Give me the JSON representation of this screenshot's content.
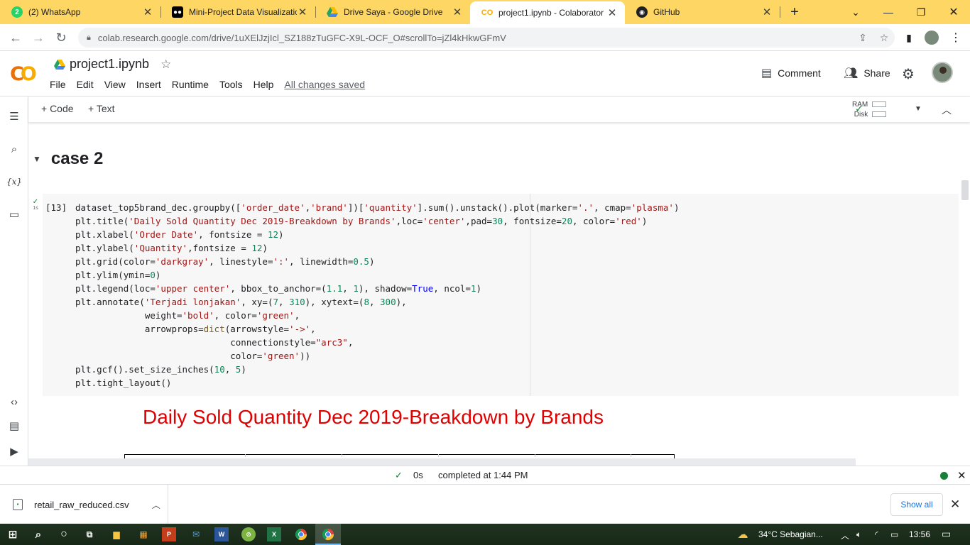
{
  "browser": {
    "tabs": [
      {
        "label": "(2) WhatsApp",
        "icon": "whatsapp-icon",
        "badge": "2",
        "active": false
      },
      {
        "label": "Mini-Project Data Visualizatio",
        "icon": "medium-icon",
        "active": false
      },
      {
        "label": "Drive Saya - Google Drive",
        "icon": "google-drive-icon",
        "active": false
      },
      {
        "label": "project1.ipynb - Colaborator",
        "icon": "colab-icon",
        "active": true
      },
      {
        "label": "GitHub",
        "icon": "github-icon",
        "active": false
      }
    ],
    "new_tab": "+",
    "url": "colab.research.google.com/drive/1uXElJzjIcl_SZ188zTuGFC-X9L-OCF_O#scrollTo=jZl4kHkwGFmV"
  },
  "colab": {
    "logo": "CO",
    "notebook_title": "project1.ipynb",
    "menu": [
      "File",
      "Edit",
      "View",
      "Insert",
      "Runtime",
      "Tools",
      "Help"
    ],
    "save_status": "All changes saved",
    "comment_label": "Comment",
    "share_label": "Share"
  },
  "toolbar": {
    "add_code": "+ Code",
    "add_text": "+ Text",
    "ram_label": "RAM",
    "disk_label": "Disk"
  },
  "notebook": {
    "section_heading": "case 2",
    "cell": {
      "exec_count": "[13]",
      "exec_time": "1s"
    },
    "chart_title": "Daily Sold Quantity Dec 2019-Breakdown by Brands"
  },
  "status": {
    "duration": "0s",
    "completed": "completed at 1:44 PM"
  },
  "downloads": {
    "file_name": "retail_raw_reduced.csv",
    "show_all": "Show all"
  },
  "taskbar": {
    "weather": "34°C  Sebagian...",
    "time": "13:56"
  },
  "colors": {
    "tabstrip": "#fdd663",
    "colab_orange": "#f9ab00",
    "chart_title": "#e00000",
    "success_green": "#188038"
  }
}
